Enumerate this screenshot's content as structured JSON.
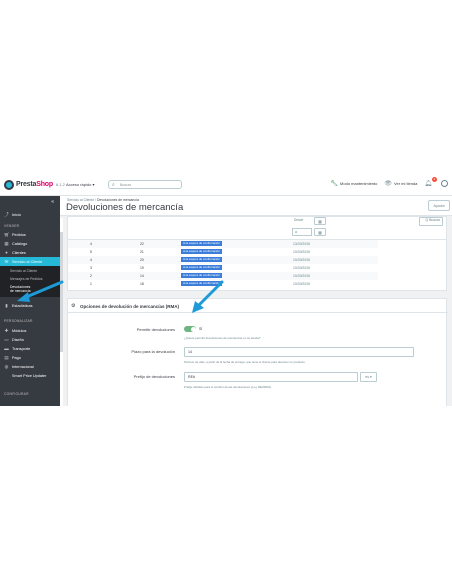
{
  "topbar": {
    "logo_text": "PrestaShop",
    "logo_prefix": "Presta",
    "logo_suffix": "Shop",
    "version": "8.1.2",
    "quick_access": "Acceso rápido ▾",
    "search_placeholder": "Buscar",
    "maintenance": "Modo mantenimiento",
    "view_store": "Ver mi tienda",
    "notif_count": "2"
  },
  "sidebar": {
    "collapse": "«",
    "items": [
      {
        "label": "Inicio",
        "icon": "trend-icon"
      },
      {
        "label": "Pedidos",
        "icon": "cart-icon"
      },
      {
        "label": "Catálogo",
        "icon": "store-icon"
      },
      {
        "label": "Clientes",
        "icon": "user-icon"
      },
      {
        "label": "Servicio al Cliente",
        "icon": "chat-icon"
      },
      {
        "label": "Estadísticas",
        "icon": "bar-chart-icon"
      },
      {
        "label": "Módulos",
        "icon": "puzzle-icon"
      },
      {
        "label": "Diseño",
        "icon": "monitor-icon"
      },
      {
        "label": "Transporte",
        "icon": "truck-icon"
      },
      {
        "label": "Pago",
        "icon": "card-icon"
      },
      {
        "label": "Internacional",
        "icon": "globe-icon"
      },
      {
        "label": "Smart Price Updater",
        "icon": ""
      }
    ],
    "subitems": [
      "Servicio al Cliente",
      "Mensajes de Pedidos",
      "Devoluciones de mercancía"
    ],
    "sections": [
      "VENDER",
      "PERSONALIZAR",
      "CONFIGURAR"
    ]
  },
  "header": {
    "breadcrumb_parent": "Servicio al Cliente",
    "breadcrumb_sep": "/",
    "breadcrumb_current": "Devoluciones de mercancía",
    "title": "Devoluciones de mercancía",
    "help": "Ayuda"
  },
  "table": {
    "filter_label": "Desde",
    "filter_value": "a",
    "search_btn": "Q Buscar",
    "rows": [
      {
        "id": "4",
        "order": "22",
        "status": "A la espera de confirmación",
        "date": "13/03/2026"
      },
      {
        "id": "5",
        "order": "21",
        "status": "A la espera de confirmación",
        "date": "10/03/2026"
      },
      {
        "id": "4",
        "order": "20",
        "status": "A la espera de confirmación",
        "date": "10/03/2026"
      },
      {
        "id": "3",
        "order": "19",
        "status": "A la espera de confirmación",
        "date": "10/03/2026"
      },
      {
        "id": "2",
        "order": "14",
        "status": "A la espera de confirmación",
        "date": "10/03/2026"
      },
      {
        "id": "1",
        "order": "18",
        "status": "A la espera de confirmación",
        "date": "10/03/2026"
      }
    ]
  },
  "options": {
    "title": "Opciones de devolución de mercancías (RMA)",
    "enable_label": "Permitir devoluciones",
    "enable_value": "SÍ",
    "enable_help": "¿Quiere permitir devoluciones de mercancías en su tienda?",
    "deadline_label": "Plazo para la devolución",
    "deadline_value": "14",
    "deadline_help": "Número de días, a partir de la fecha de entrega, que tiene el cliente para devolver un producto.",
    "prefix_label": "Prefijo de devoluciones",
    "prefix_value": "RE#",
    "prefix_lang": "es ▾",
    "prefix_help": "Prefijo utilizado para el nombre de las devoluciones (p.ej. RE00001)."
  },
  "colors": {
    "sidebar": "#363a41",
    "accent": "#25b9d7",
    "toggle_on": "#70b580",
    "status_badge": "#3b7dd8",
    "arrow": "#1e9bd7"
  }
}
